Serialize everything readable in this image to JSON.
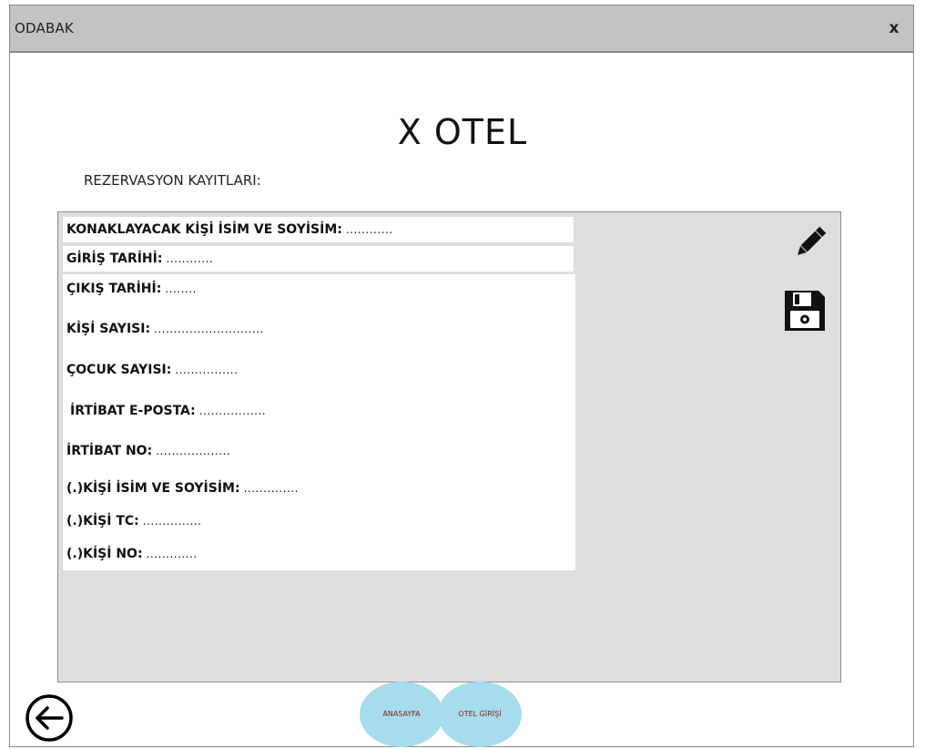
{
  "window": {
    "title": "ODABAK",
    "close_label": "x"
  },
  "header": {
    "hotel_title": "X OTEL",
    "section_label": "REZERVASYON KAYITLARI:"
  },
  "form": {
    "fields": [
      {
        "label": "KONAKLAYACAK KİŞİ İSİM VE SOYİSİM:",
        "value": "............"
      },
      {
        "label": "GİRİŞ TARİHİ:",
        "value": "............"
      },
      {
        "label": "ÇIKIŞ TARİHİ:",
        "value": "........"
      },
      {
        "label": "KİŞİ SAYISI:",
        "value": "............................"
      },
      {
        "label": "ÇOCUK SAYISI:",
        "value": "................"
      },
      {
        "label": "İRTİBAT E-POSTA:",
        "value": "................."
      },
      {
        "label": "İRTİBAT NO:",
        "value": "..................."
      },
      {
        "label": "(.)KİŞİ İSİM VE SOYİSİM:",
        "value": ".............."
      },
      {
        "label": "(.)KİŞİ TC:",
        "value": "..............."
      },
      {
        "label": "(.)KİŞİ NO:",
        "value": "............."
      }
    ]
  },
  "toolbar": {
    "edit_icon": "pencil-icon",
    "save_icon": "floppy-disk-icon"
  },
  "footer": {
    "back_icon": "arrow-left-circle-icon",
    "home_label": "ANASAYFA",
    "hotel_login_label": "OTEL GİRİŞİ"
  },
  "colors": {
    "titlebar": "#c3c3c3",
    "panel": "#dedede",
    "nav_button": "#a6dcec",
    "nav_text": "#8b1a1a"
  }
}
